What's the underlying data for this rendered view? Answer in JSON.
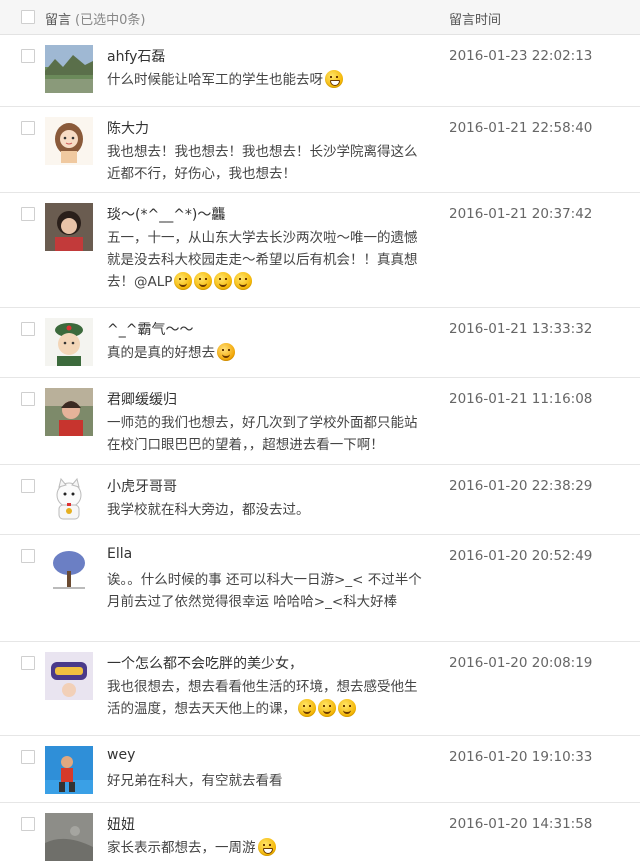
{
  "header": {
    "title": "留言",
    "selected_count": "(已选中0条)",
    "time_col": "留言时间"
  },
  "comments": [
    {
      "name": "ahfy石磊",
      "text": "什么时候能让哈军工的学生也能去呀",
      "time": "2016-01-23 22:02:13",
      "avatar": "landscape-avatar",
      "emoji": [
        "grin-emoji"
      ]
    },
    {
      "name": "陈大力",
      "text": "我也想去！我也想去！我也想去！长沙学院离得这么近都不行，好伤心，我也想去！",
      "time": "2016-01-21 22:58:40",
      "avatar": "cartoon-girl-avatar",
      "emoji": []
    },
    {
      "name": "琰～(*^__^*)～龘",
      "text": "五一，十一，从山东大学去长沙两次啦～唯一的遗憾就是没去科大校园走走～希望以后有机会！！真真想去！@ALP",
      "time": "2016-01-21 20:37:42",
      "avatar": "girl-photo-avatar",
      "emoji": [
        "smile-emoji",
        "smile-emoji",
        "smile-emoji",
        "smile-emoji"
      ]
    },
    {
      "name": "^_^霸气～～",
      "text": "真的是真的好想去",
      "time": "2016-01-21 13:33:32",
      "avatar": "soldier-cartoon-avatar",
      "emoji": [
        "shy-emoji"
      ]
    },
    {
      "name": "君卿缓缓归",
      "text": "一师范的我们也想去，好几次到了学校外面都只能站在校门口眼巴巴的望着，，超想进去看一下啊！",
      "time": "2016-01-21 11:16:08",
      "avatar": "person-photo-avatar",
      "emoji": []
    },
    {
      "name": "小虎牙哥哥",
      "text": "我学校就在科大旁边，都没去过。",
      "time": "2016-01-20 22:38:29",
      "avatar": "lucky-cat-avatar",
      "emoji": []
    },
    {
      "name": "Ella",
      "text": "诶。。什么时候的事 还可以科大一日游>_< 不过半个月前去过了依然觉得很幸运 哈哈哈>_<科大好棒",
      "time": "2016-01-20 20:52:49",
      "avatar": "tree-avatar",
      "emoji": []
    },
    {
      "name": "一个怎么都不会吃胖的美少女，",
      "text": "我也很想去，想去看看他生活的环境，想去感受他生活的温度，想去天天他上的课，",
      "time": "2016-01-20 20:08:19",
      "avatar": "sticker-avatar",
      "emoji": [
        "smile-emoji",
        "smile-emoji",
        "smile-emoji"
      ]
    },
    {
      "name": "wey",
      "text": "好兄弟在科大，有空就去看看",
      "time": "2016-01-20 19:10:33",
      "avatar": "runner-photo-avatar",
      "emoji": []
    },
    {
      "name": "妞妞",
      "text": "家长表示都想去，一周游",
      "time": "2016-01-20 14:31:58",
      "avatar": "gray-photo-avatar",
      "emoji": [
        "grin-emoji"
      ]
    }
  ]
}
